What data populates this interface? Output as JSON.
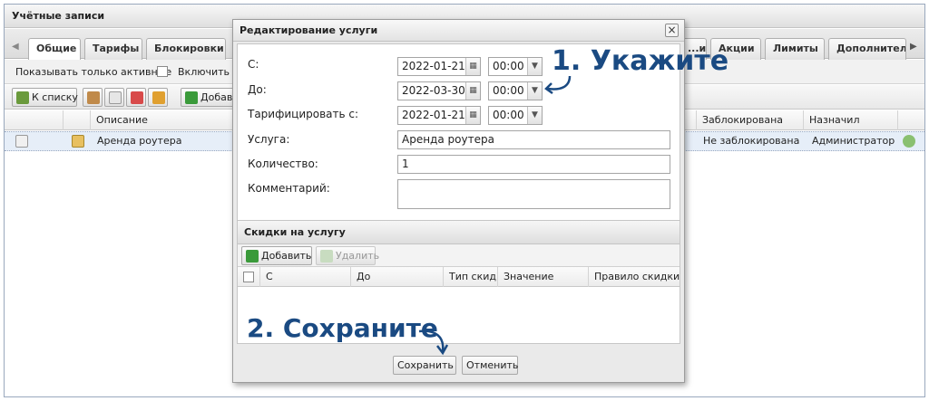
{
  "window": {
    "title": "Учётные записи"
  },
  "tabs": [
    "Общие",
    "Тарифы",
    "Блокировки",
    "...ие",
    "Акции",
    "Лимиты",
    "Дополнитель..."
  ],
  "filter": {
    "show_active_label": "Показывать только активные",
    "include_label": "Включить п"
  },
  "toolbar": {
    "to_list": "К списку",
    "add": "Добави"
  },
  "grid": {
    "columns": [
      "Описание",
      "Заблокирована",
      "Назначил"
    ],
    "row": {
      "description": "Аренда роутера",
      "blocked": "Не заблокирована",
      "assigned_by": "Администратор"
    }
  },
  "dialog": {
    "title": "Редактирование услуги",
    "close": "×",
    "from_label": "С:",
    "from_date": "2022-01-21",
    "from_time": "00:00",
    "to_label": "До:",
    "to_date": "2022-03-30",
    "to_time": "00:00",
    "charge_label": "Тарифицировать с:",
    "charge_date": "2022-01-21",
    "charge_time": "00:00",
    "service_label": "Услуга:",
    "service_value": "Аренда роутера",
    "qty_label": "Количество:",
    "qty_value": "1",
    "comment_label": "Комментарий:",
    "comment_value": ""
  },
  "discounts": {
    "title": "Скидки на услугу",
    "add": "Добавить",
    "delete": "Удалить",
    "columns": [
      "С",
      "До",
      "Тип скидки",
      "Значение",
      "Правило скидки"
    ]
  },
  "buttons": {
    "save": "Сохранить",
    "cancel": "Отменить"
  },
  "annotations": {
    "step1": "1. Укажите",
    "step2": "2. Сохраните"
  },
  "colors": {
    "annotation": "#1a4a82",
    "selected_row": "#e6eef8"
  }
}
